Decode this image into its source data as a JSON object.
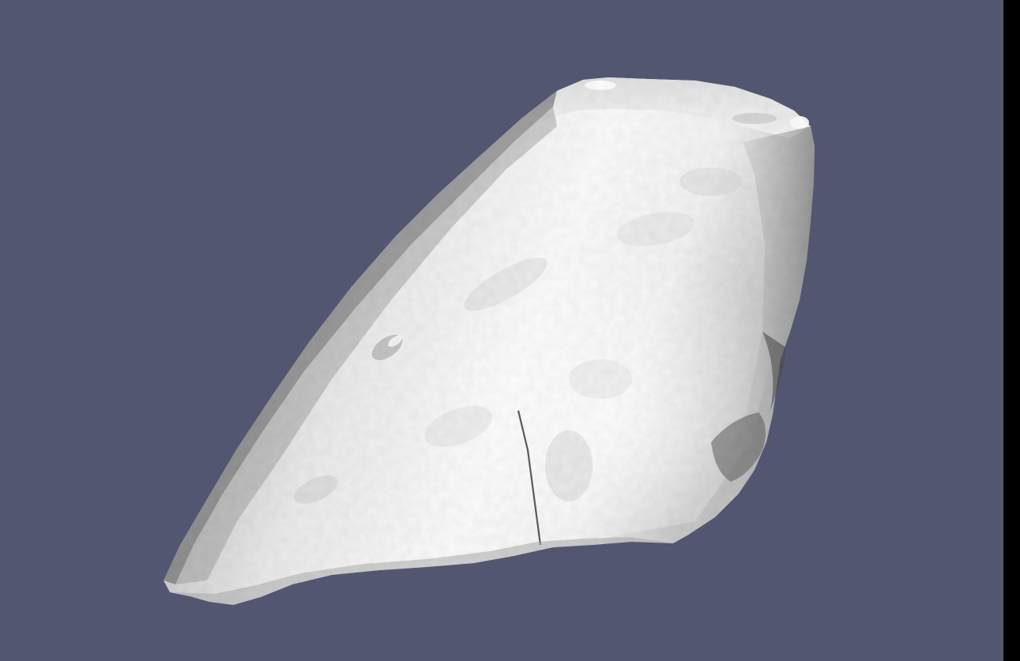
{
  "viewer": {
    "background_color": "#525670",
    "edge_strip_color": "#000000",
    "model": {
      "name": "rock-mesh",
      "surface_colors": {
        "highlight": "#ffffff",
        "light": "#eeeeee",
        "mid": "#c9c9c9",
        "shadow": "#8a8a8a",
        "deep_shadow": "#4a4a4a"
      }
    }
  }
}
